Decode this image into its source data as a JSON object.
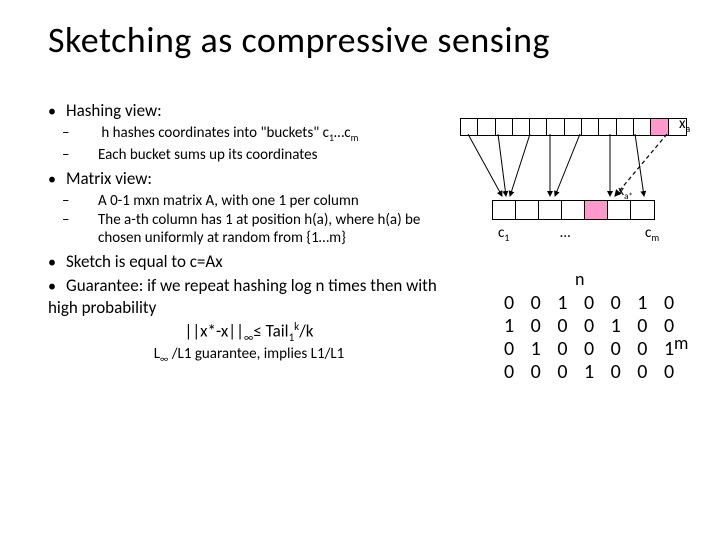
{
  "title": "Sketching as compressive sensing",
  "bullets": {
    "b1": "Hashing view:",
    "b1a": "h hashes coordinates into  \"buckets\" c",
    "b1a_sub1": "1",
    "b1a_mid": "…c",
    "b1a_sub2": "m",
    "b1b": "Each bucket sums up its coordinates",
    "b2": "Matrix view:",
    "b2a": "A 0-1 mxn matrix A, with one 1 per column",
    "b2b": "The a-th column has 1 at position h(a), where h(a) be chosen uniformly at random from {1…m}",
    "b3": "Sketch is equal to c=Ax",
    "b4": "Guarantee: if we repeat hashing log n times then with high probability"
  },
  "formula": {
    "lhs": "||x*-x||",
    "sub1": "∞",
    "mid": "≤  Tail",
    "sub2": "1",
    "sup2": "k",
    "rhs": "/k"
  },
  "subline": {
    "a": "L",
    "s1": "∞",
    "b": " /L1 guarantee, implies L1/L1"
  },
  "diagram": {
    "xa": "x",
    "xa_sub": "a",
    "xastar": "x",
    "xastar_sub": "a*",
    "c1": "c",
    "c1_sub": "1",
    "dots": "…",
    "cm": "c",
    "cm_sub": "m",
    "n": "n",
    "m": "m",
    "matrix_rows": [
      "0 0 1 0 0 1 0",
      "1 0 0 0 1 0 0",
      "0 1 0 0 0 0 1",
      "0 0 0 1 0 0 0"
    ]
  }
}
